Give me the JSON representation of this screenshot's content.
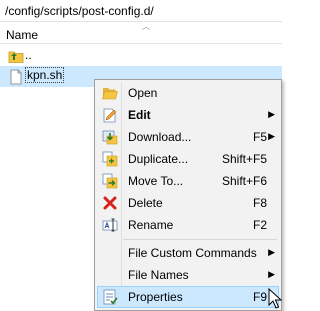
{
  "path": "/config/scripts/post-config.d/",
  "header": {
    "name_col": "Name"
  },
  "files": [
    {
      "label": "..",
      "icon": "parent-folder-icon"
    },
    {
      "label": "kpn.sh",
      "icon": "file-icon",
      "selected": true
    }
  ],
  "menu": {
    "items": [
      {
        "label": "Open",
        "icon": "open-folder-icon"
      },
      {
        "label": "Edit",
        "icon": "edit-icon",
        "submenu": true,
        "bold": true
      },
      {
        "label": "Download...",
        "icon": "download-icon",
        "shortcut": "F5",
        "submenu": true
      },
      {
        "label": "Duplicate...",
        "icon": "duplicate-icon",
        "shortcut": "Shift+F5"
      },
      {
        "label": "Move To...",
        "icon": "move-icon",
        "shortcut": "Shift+F6"
      },
      {
        "label": "Delete",
        "icon": "delete-icon",
        "shortcut": "F8"
      },
      {
        "label": "Rename",
        "icon": "rename-icon",
        "shortcut": "F2"
      },
      {
        "label": "File Custom Commands",
        "submenu": true
      },
      {
        "label": "File Names",
        "submenu": true
      },
      {
        "label": "Properties",
        "icon": "properties-icon",
        "shortcut": "F9",
        "hover": true
      }
    ],
    "submenu_arrow": "▶"
  },
  "colors": {
    "selection": "#cce8ff",
    "menu_bg": "#f2f2f2",
    "delete_x": "#d9201c",
    "folder": "#f5c542"
  }
}
